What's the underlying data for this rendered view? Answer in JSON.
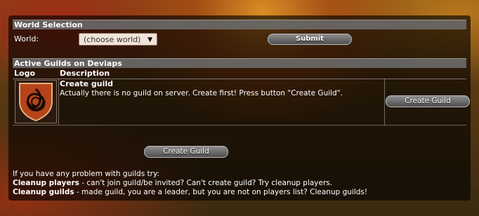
{
  "world_selection": {
    "title": "World Selection",
    "label": "World:",
    "select_value": "(choose world)",
    "submit_label": "Submit"
  },
  "active_guilds": {
    "title": "Active Guilds on Deviaps",
    "col_logo": "Logo",
    "col_description": "Description",
    "row": {
      "name": "Create guild",
      "text": "Actually there is no guild on server. Create first! Press button \"Create Guild\".",
      "button_label": "Create Guild",
      "logo_icon": "celtic-knot-shield-icon"
    }
  },
  "create_guild_button": "Create Guild",
  "help": {
    "intro": "If you have any problem with guilds try:",
    "cleanup_players_label": "Cleanup players",
    "cleanup_players_text": " - can't join guild/be invited? Can't create guild? Try cleanup players.",
    "cleanup_guilds_label": "Cleanup guilds",
    "cleanup_guilds_text": " - made guild, you are a leader, but you are not on players list? Cleanup guilds!"
  },
  "colors": {
    "panel_bg": "#000000",
    "section_bar": "#6e6e6e",
    "button_top": "#8d8d8d",
    "button_bottom": "#4e4e4e"
  }
}
